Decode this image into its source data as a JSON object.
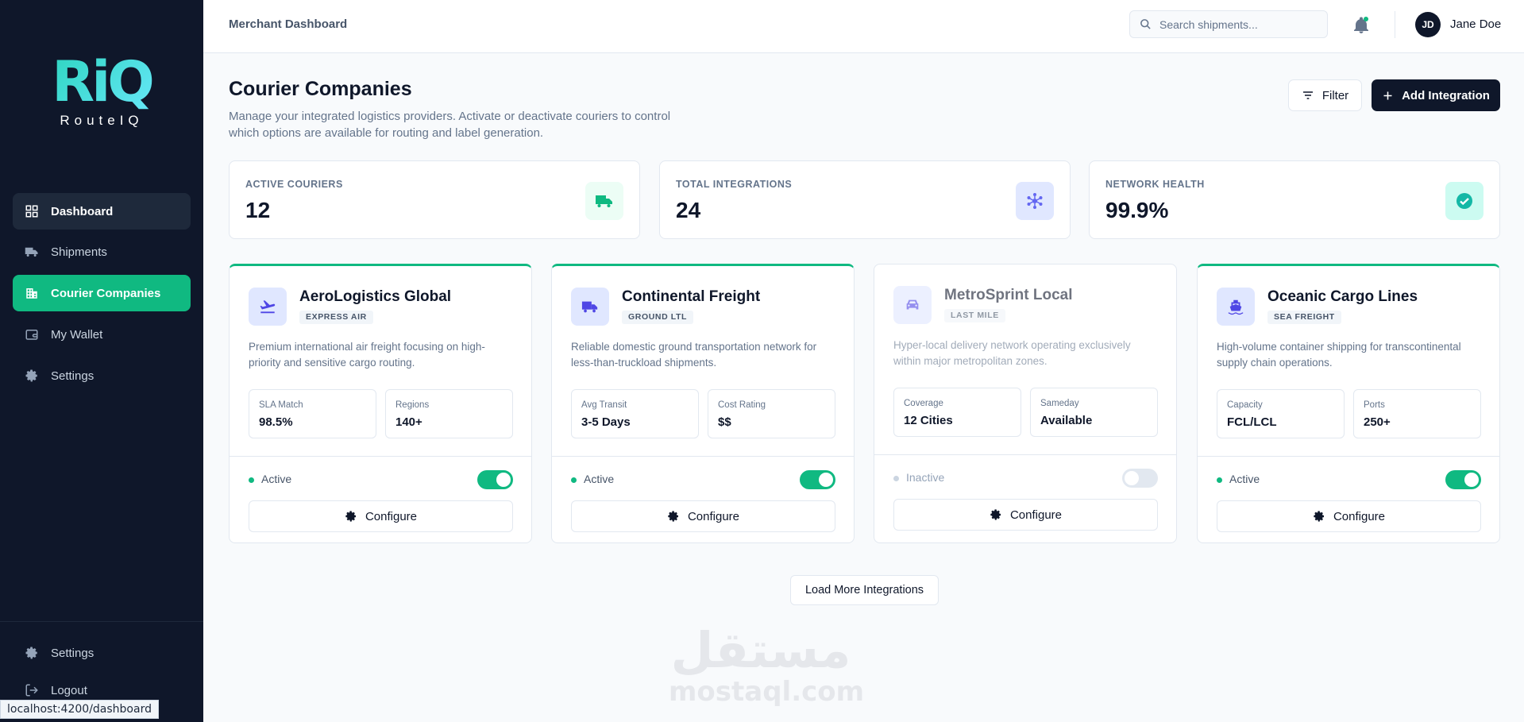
{
  "brand": {
    "logo_mark": "RiQ",
    "name": "RouteIQ"
  },
  "sidebar": {
    "items": [
      {
        "label": "Dashboard",
        "icon": "grid-icon"
      },
      {
        "label": "Shipments",
        "icon": "truck-icon"
      },
      {
        "label": "Courier Companies",
        "icon": "building-icon"
      },
      {
        "label": "My Wallet",
        "icon": "wallet-icon"
      },
      {
        "label": "Settings",
        "icon": "gear-icon"
      }
    ],
    "bottom": [
      {
        "label": "Settings",
        "icon": "gear-icon"
      },
      {
        "label": "Logout",
        "icon": "logout-icon"
      }
    ]
  },
  "status_bar": {
    "url": "localhost:4200/dashboard"
  },
  "topbar": {
    "title": "Merchant Dashboard",
    "search_placeholder": "Search shipments...",
    "user": {
      "initials": "JD",
      "name": "Jane Doe"
    }
  },
  "page": {
    "title": "Courier Companies",
    "description": "Manage your integrated logistics providers. Activate or deactivate couriers to control which options are available for routing and label generation.",
    "filter_label": "Filter",
    "add_label": "Add Integration"
  },
  "stats": [
    {
      "label": "ACTIVE COURIERS",
      "value": "12",
      "icon": "truck-icon",
      "color": "#10b981"
    },
    {
      "label": "TOTAL INTEGRATIONS",
      "value": "24",
      "icon": "hub-icon",
      "color": "#6366f1"
    },
    {
      "label": "NETWORK HEALTH",
      "value": "99.9%",
      "icon": "check-circle-icon",
      "color": "#14b8a6"
    }
  ],
  "couriers": [
    {
      "name": "AeroLogistics Global",
      "tag": "EXPRESS AIR",
      "icon": "plane-icon",
      "description": "Premium international air freight focusing on high-priority and sensitive cargo routing.",
      "metrics": [
        {
          "label": "SLA Match",
          "value": "98.5%"
        },
        {
          "label": "Regions",
          "value": "140+"
        }
      ],
      "status": "Active",
      "enabled": true,
      "configure_label": "Configure"
    },
    {
      "name": "Continental Freight",
      "tag": "GROUND LTL",
      "icon": "truck-icon",
      "description": "Reliable domestic ground transportation network for less-than-truckload shipments.",
      "metrics": [
        {
          "label": "Avg Transit",
          "value": "3-5 Days"
        },
        {
          "label": "Cost Rating",
          "value": "$$"
        }
      ],
      "status": "Active",
      "enabled": true,
      "configure_label": "Configure"
    },
    {
      "name": "MetroSprint Local",
      "tag": "LAST MILE",
      "icon": "car-icon",
      "description": "Hyper-local delivery network operating exclusively within major metropolitan zones.",
      "metrics": [
        {
          "label": "Coverage",
          "value": "12 Cities"
        },
        {
          "label": "Sameday",
          "value": "Available"
        }
      ],
      "status": "Inactive",
      "enabled": false,
      "configure_label": "Configure"
    },
    {
      "name": "Oceanic Cargo Lines",
      "tag": "SEA FREIGHT",
      "icon": "ship-icon",
      "description": "High-volume container shipping for transcontinental supply chain operations.",
      "metrics": [
        {
          "label": "Capacity",
          "value": "FCL/LCL"
        },
        {
          "label": "Ports",
          "value": "250+"
        }
      ],
      "status": "Active",
      "enabled": true,
      "configure_label": "Configure"
    }
  ],
  "load_more_label": "Load More Integrations",
  "watermark": {
    "arabic": "مستقل",
    "latin": "mostaql.com"
  }
}
